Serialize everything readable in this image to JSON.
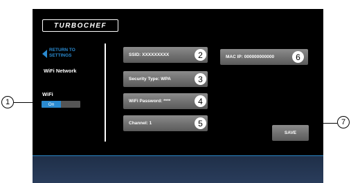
{
  "app": {
    "logo_text": "TURBOCHEF"
  },
  "sidebar": {
    "return_label": "RETURN TO SETTINGS",
    "section_title": "WiFi Network",
    "wifi_label": "WiFi",
    "toggle_on_label": "On",
    "toggle_state": "on"
  },
  "fields": {
    "ssid": "SSID: XXXXXXXXX",
    "security": "Security Type: WPA",
    "password": "WiFi Password: ****",
    "channel": "Channel: 1",
    "mac": "MAC IP: 000000000000"
  },
  "buttons": {
    "save_label": "SAVE"
  },
  "badges": {
    "ssid": "2",
    "security": "3",
    "password": "4",
    "channel": "5",
    "mac": "6"
  },
  "callouts": {
    "toggle": "1",
    "save": "7"
  },
  "colors": {
    "accent": "#2a8ad0",
    "screen_background": "#000000",
    "field_background": "#6e6e6e",
    "footer_band": "#25364f"
  }
}
